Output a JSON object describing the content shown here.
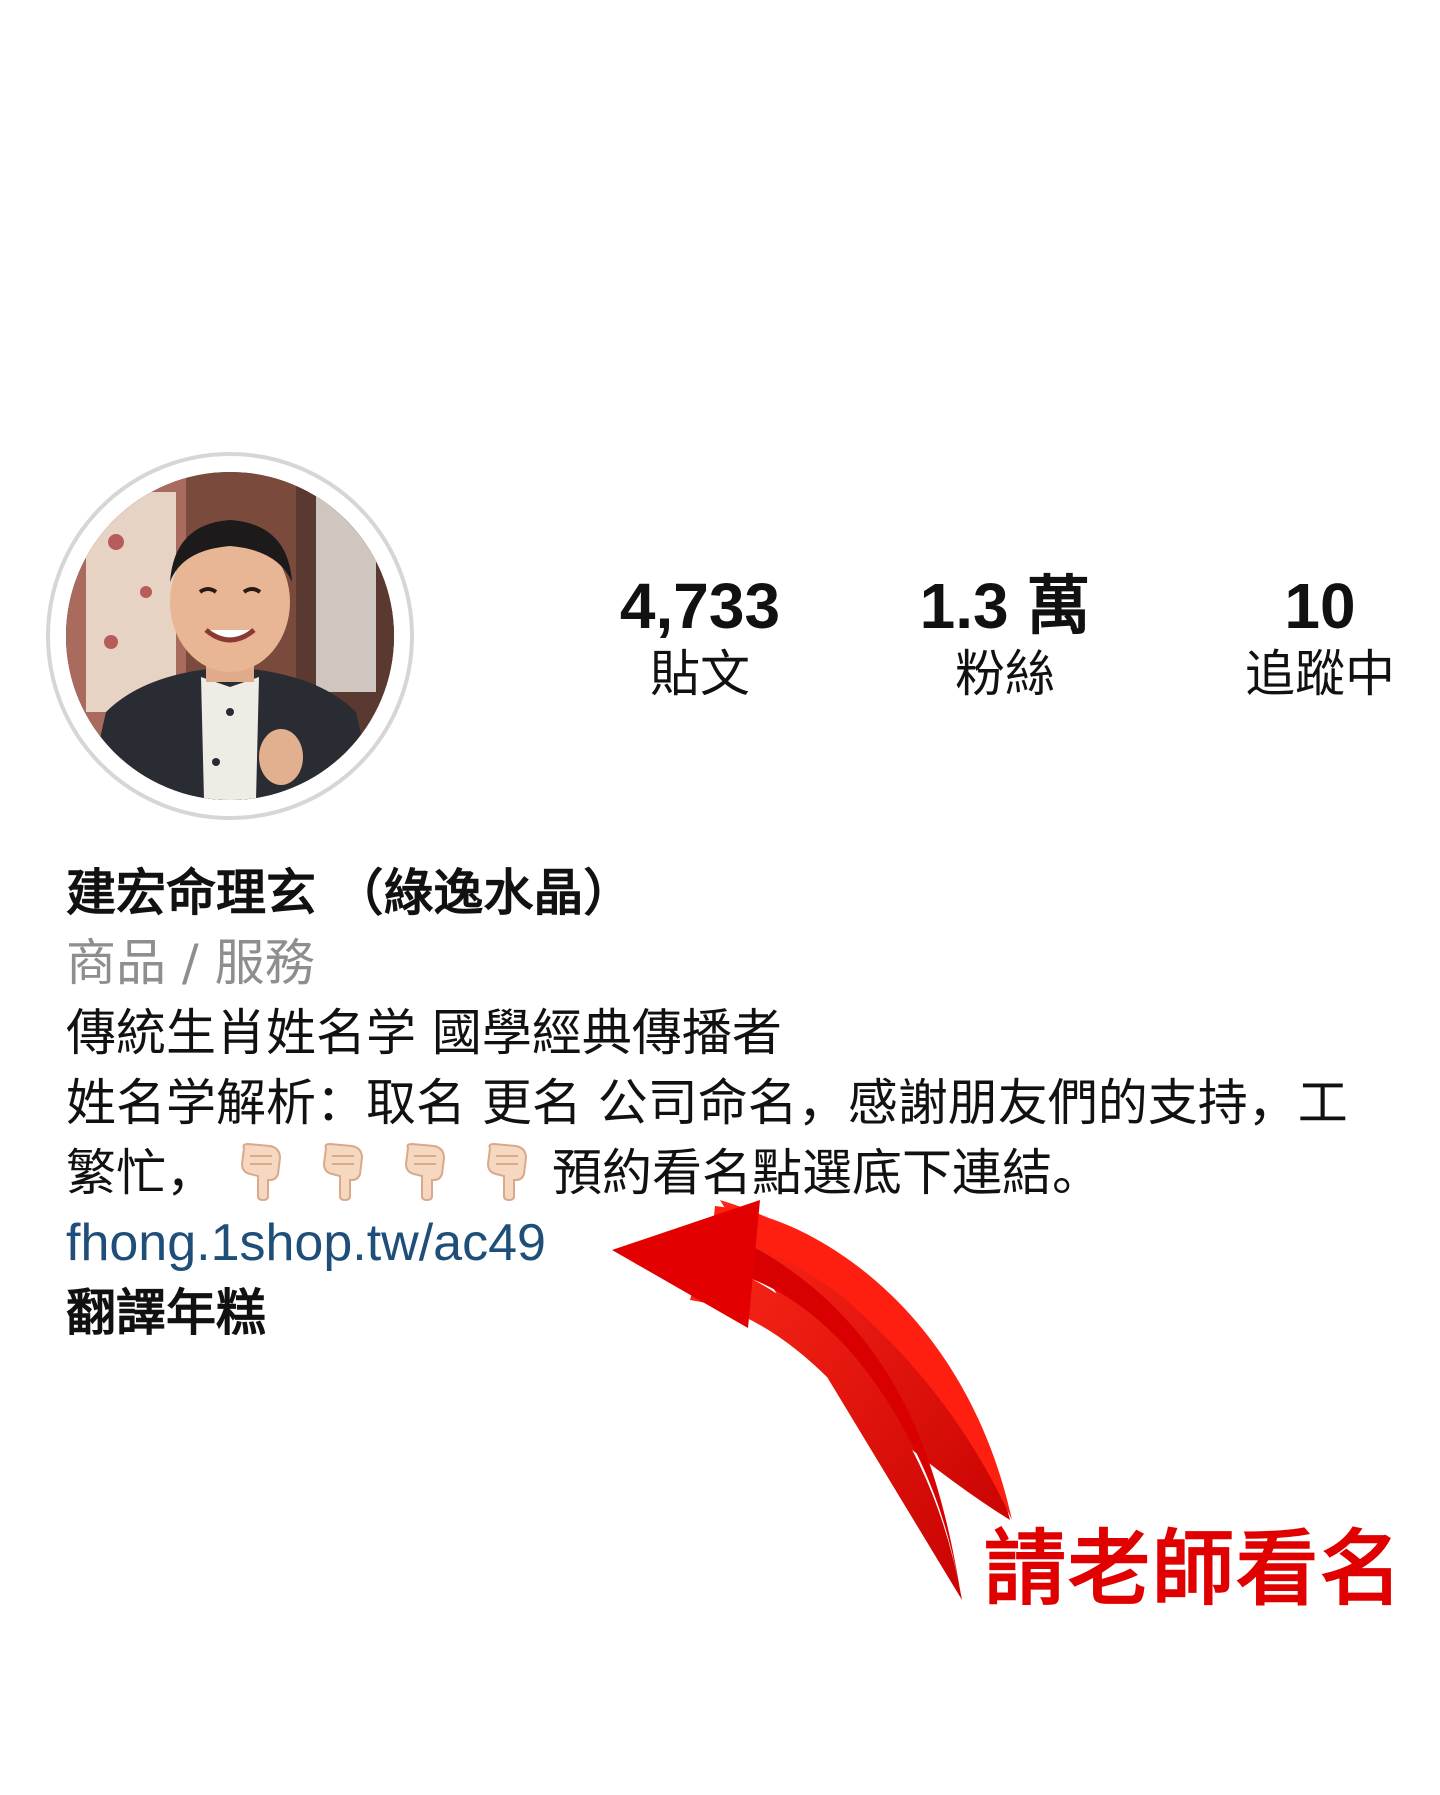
{
  "profile": {
    "stats": [
      {
        "count": "4,733",
        "label": "貼文"
      },
      {
        "count": "1.3 萬",
        "label": "粉絲"
      },
      {
        "count": "10",
        "label": "追蹤中"
      }
    ],
    "name": "建宏命理玄 （綠逸水晶）",
    "category": "商品 / 服務",
    "bio_line1": "傳統生肖姓名学 國學經典傳播者",
    "bio_line2": "姓名学解析：取名 更名 公司命名，感謝朋友們的支持，工",
    "bio_line3_prefix": "繁忙，",
    "bio_line3_suffix": "預約看名點選底下連結。",
    "hand_icon": "backhand-index-pointing-down-icon",
    "link": "fhong.1shop.tw/ac49",
    "translate": "翻譯年糕"
  },
  "annotation": {
    "text": "請老師看名",
    "color": "#e00000"
  },
  "colors": {
    "link": "#1f4e79",
    "category": "#8e8e8e",
    "avatar_ring": "#d6d6d6"
  }
}
